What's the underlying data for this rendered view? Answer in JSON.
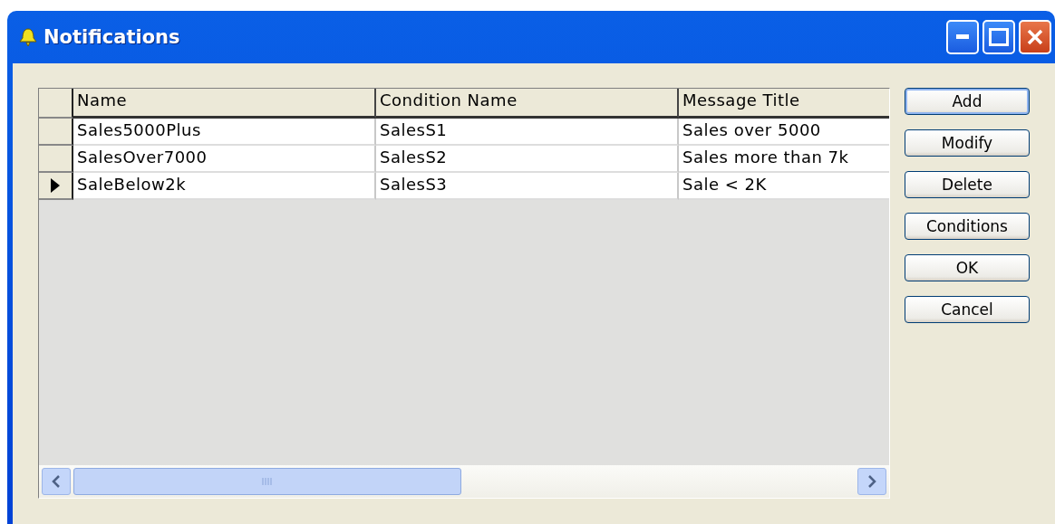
{
  "window": {
    "title": "Notifications"
  },
  "table": {
    "columns": [
      "Name",
      "Condition Name",
      "Message Title"
    ],
    "rows": [
      {
        "cells": [
          "Sales5000Plus",
          "SalesS1",
          "Sales over 5000"
        ],
        "selected": false
      },
      {
        "cells": [
          "SalesOver7000",
          "SalesS2",
          "Sales more than 7k"
        ],
        "selected": false
      },
      {
        "cells": [
          "SaleBelow2k",
          "SalesS3",
          "Sale < 2K"
        ],
        "selected": true
      }
    ]
  },
  "buttons": [
    {
      "label": "Add",
      "default": true
    },
    {
      "label": "Modify",
      "default": false
    },
    {
      "label": "Delete",
      "default": false
    },
    {
      "label": "Conditions",
      "default": false
    },
    {
      "label": "OK",
      "default": false
    },
    {
      "label": "Cancel",
      "default": false
    }
  ]
}
